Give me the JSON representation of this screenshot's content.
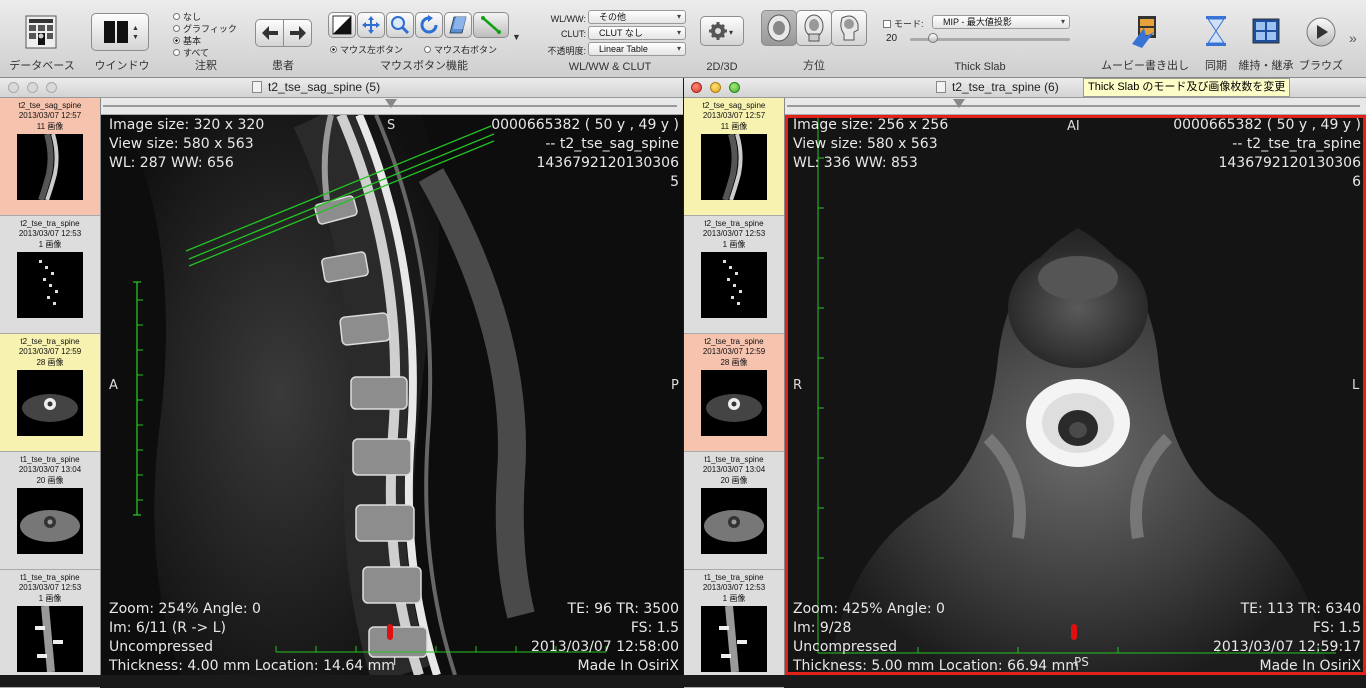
{
  "toolbar": {
    "groups": {
      "database": "データベース",
      "window": "ウインドウ",
      "annotation": "注釈",
      "patient": "患者",
      "mouse": "マウスボタン機能",
      "wlww": "WL/WW & CLUT",
      "dim": "2D/3D",
      "orientation": "方位",
      "thickslab": "Thick Slab",
      "movie": "ムービー書き出し",
      "sync": "同期",
      "keep": "維持・継承",
      "browse": "ブラウズ"
    },
    "annotation_options": [
      "なし",
      "グラフィック",
      "基本",
      "すべて"
    ],
    "annotation_selected": "基本",
    "mouse_left": "マウス左ボタン",
    "mouse_right": "マウス右ボタン",
    "wl_label": "WL/WW:",
    "wl_value": "その他",
    "clut_label": "CLUT:",
    "clut_value": "CLUT なし",
    "opacity_label": "不透明度:",
    "opacity_value": "Linear Table",
    "slab_mode_label": "モード:",
    "slab_mode_value": "MIP - 最大値投影",
    "slab_count": "20"
  },
  "tooltip": "Thick Slab のモード及び画像枚数を変更",
  "thumbnails": [
    {
      "name": "t2_tse_sag_spine",
      "date": "2013/03/07 12:57",
      "count": "11 画像"
    },
    {
      "name": "t2_tse_tra_spine",
      "date": "2013/03/07 12:53",
      "count": "1 画像"
    },
    {
      "name": "t2_tse_tra_spine",
      "date": "2013/03/07 12:59",
      "count": "28 画像"
    },
    {
      "name": "t1_tse_tra_spine",
      "date": "2013/03/07 13:04",
      "count": "20 画像"
    },
    {
      "name": "t1_tse_tra_spine",
      "date": "2013/03/07 12:53",
      "count": "1 画像"
    }
  ],
  "left": {
    "title": "t2_tse_sag_spine (5)",
    "tl": [
      "Image size: 320 x 320",
      "View size: 580 x 563",
      "WL: 287 WW: 656"
    ],
    "tr": [
      "0000665382 ( 50 y , 49 y )",
      "-- t2_tse_sag_spine",
      "1436792120130306",
      "5"
    ],
    "bl": [
      "Zoom: 254% Angle: 0",
      "Im: 6/11  (R -> L)",
      "Uncompressed",
      "Thickness: 4.00 mm Location: 14.64 mm"
    ],
    "br": [
      "TE:  96 TR:  3500",
      "FS:  1.5",
      "2013/03/07 12:58:00",
      "Made In OsiriX"
    ],
    "orient_top": "S",
    "orient_left": "A",
    "orient_right": "P",
    "orient_bottom": "I"
  },
  "right": {
    "title": "t2_tse_tra_spine (6)",
    "tl": [
      "Image size: 256 x 256",
      "View size: 580 x 563",
      "WL: 336 WW: 853"
    ],
    "tr": [
      "0000665382 ( 50 y , 49 y )",
      "-- t2_tse_tra_spine",
      "1436792120130306",
      "6"
    ],
    "bl": [
      "Zoom: 425% Angle: 0",
      "Im: 9/28",
      "Uncompressed",
      "Thickness: 5.00 mm Location: 66.94 mm"
    ],
    "br": [
      "TE:  113 TR:  6340",
      "FS:  1.5",
      "2013/03/07 12:59:17",
      "Made In OsiriX"
    ],
    "orient_top": "AI",
    "orient_left": "R",
    "orient_right": "L",
    "orient_bottom": "PS"
  },
  "colors": {
    "highlight_salmon": "#f6c3ae",
    "highlight_yellow": "#f7f2b0",
    "active_border": "#e0221a",
    "annot_green": "#23c323"
  }
}
